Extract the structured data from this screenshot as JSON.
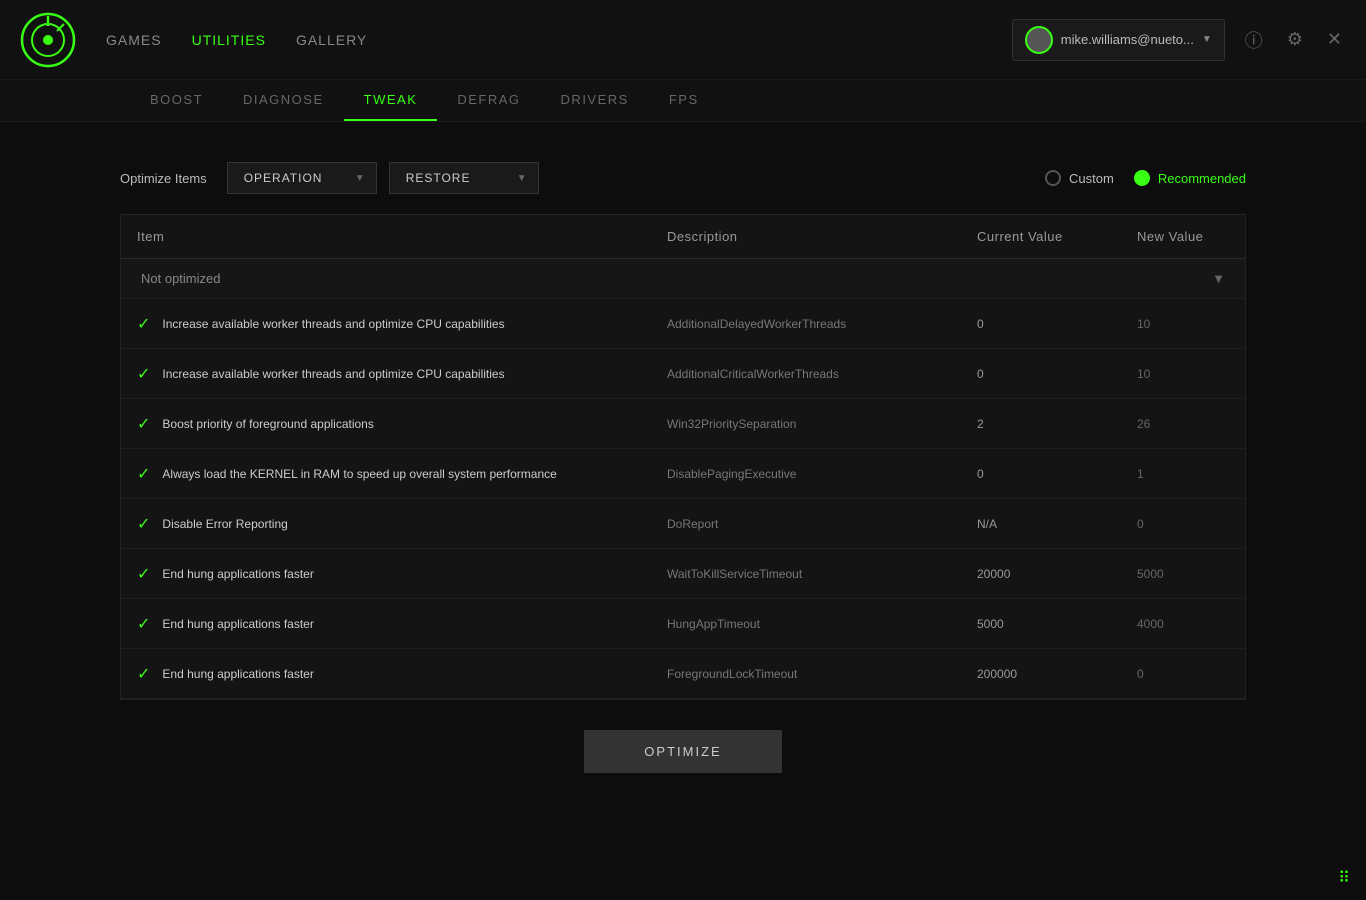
{
  "app": {
    "logo_symbol": "⊙"
  },
  "nav": {
    "main_items": [
      {
        "label": "GAMES",
        "active": false
      },
      {
        "label": "UTILITIES",
        "active": true
      },
      {
        "label": "GALLERY",
        "active": false
      }
    ],
    "sub_items": [
      {
        "label": "BOOST",
        "active": false
      },
      {
        "label": "DIAGNOSE",
        "active": false
      },
      {
        "label": "TWEAK",
        "active": true
      },
      {
        "label": "DEFRAG",
        "active": false
      },
      {
        "label": "DRIVERS",
        "active": false
      },
      {
        "label": "FPS",
        "active": false
      }
    ]
  },
  "header": {
    "user_name": "mike.williams@nueto...",
    "info_icon": "ℹ",
    "settings_icon": "⚙",
    "close_icon": "✕"
  },
  "toolbar": {
    "optimize_label": "Optimize Items",
    "operation_label": "OPERATION",
    "restore_label": "RESTORE",
    "custom_label": "Custom",
    "recommended_label": "Recommended"
  },
  "table": {
    "columns": [
      "Item",
      "Description",
      "Current Value",
      "New Value"
    ],
    "not_optimized_label": "Not optimized",
    "rows": [
      {
        "item": "Increase available worker threads and optimize CPU capabilities",
        "description": "AdditionalDelayedWorkerThreads",
        "current_value": "0",
        "new_value": "10"
      },
      {
        "item": "Increase available worker threads and optimize CPU capabilities",
        "description": "AdditionalCriticalWorkerThreads",
        "current_value": "0",
        "new_value": "10"
      },
      {
        "item": "Boost priority of foreground applications",
        "description": "Win32PrioritySeparation",
        "current_value": "2",
        "new_value": "26"
      },
      {
        "item": "Always load the KERNEL in RAM to speed up overall system performance",
        "description": "DisablePagingExecutive",
        "current_value": "0",
        "new_value": "1"
      },
      {
        "item": "Disable Error Reporting",
        "description": "DoReport",
        "current_value": "N/A",
        "new_value": "0"
      },
      {
        "item": "End hung applications faster",
        "description": "WaitToKillServiceTimeout",
        "current_value": "20000",
        "new_value": "5000"
      },
      {
        "item": "End hung applications faster",
        "description": "HungAppTimeout",
        "current_value": "5000",
        "new_value": "4000"
      },
      {
        "item": "End hung applications faster",
        "description": "ForegroundLockTimeout",
        "current_value": "200000",
        "new_value": "0"
      }
    ]
  },
  "buttons": {
    "optimize_label": "OPTIMIZE"
  },
  "colors": {
    "green": "#39ff14",
    "dark_bg": "#0d0d0d",
    "panel_bg": "#141414"
  }
}
